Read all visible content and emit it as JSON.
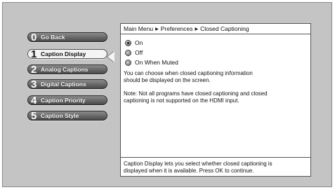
{
  "menu": {
    "items": [
      {
        "num": "0",
        "label": "Go Back"
      },
      {
        "num": "1",
        "label": "Caption Display"
      },
      {
        "num": "2",
        "label": "Analog Captions"
      },
      {
        "num": "3",
        "label": "Digital Captions"
      },
      {
        "num": "4",
        "label": "Caption Priority"
      },
      {
        "num": "5",
        "label": "Caption Style"
      }
    ],
    "selected_index": 1
  },
  "breadcrumb": {
    "parts": [
      "Main Menu",
      "Preferences",
      "Closed Captioning"
    ],
    "separator": "▶"
  },
  "options": [
    {
      "label": "On",
      "checked": true
    },
    {
      "label": "Off",
      "checked": false
    },
    {
      "label": "On When Muted",
      "checked": false
    }
  ],
  "description": {
    "line1": "You can choose when closed captioning information",
    "line2": "should be displayed on the screen.",
    "note1": "Note: Not all programs have closed captioning and closed",
    "note2": "captioning is not supported on the HDMI input."
  },
  "help": {
    "line1": "Caption Display lets you select whether closed captioning is",
    "line2": "displayed when it is available. Press OK to continue."
  }
}
